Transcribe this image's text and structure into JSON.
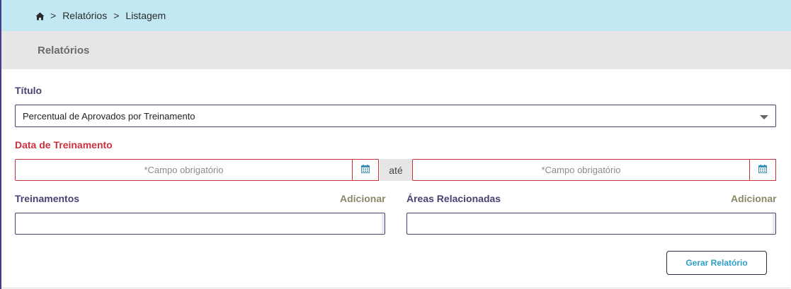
{
  "breadcrumb": {
    "home_icon": "home-icon",
    "separator": ">",
    "items": [
      "Relatórios",
      "Listagem"
    ]
  },
  "header": {
    "title": "Relatórios"
  },
  "form": {
    "titulo": {
      "label": "Título",
      "selected": "Percentual de Aprovados por Treinamento"
    },
    "data_treinamento": {
      "label": "Data de Treinamento",
      "start_placeholder": "*Campo obrigatório",
      "range_separator": "até",
      "end_placeholder": "*Campo obrigatório",
      "calendar_icon": "calendar-icon"
    },
    "treinamentos": {
      "label": "Treinamentos",
      "add_label": "Adicionar"
    },
    "areas": {
      "label": "Áreas Relacionadas",
      "add_label": "Adicionar"
    },
    "submit_label": "Gerar Relatório"
  },
  "colors": {
    "breadcrumb_bg": "#c2e8f3",
    "header_bg": "#e6e6e6",
    "label": "#4b3f72",
    "required": "#c8323c",
    "add_link": "#8a8768",
    "button_text": "#2aa0c8"
  }
}
